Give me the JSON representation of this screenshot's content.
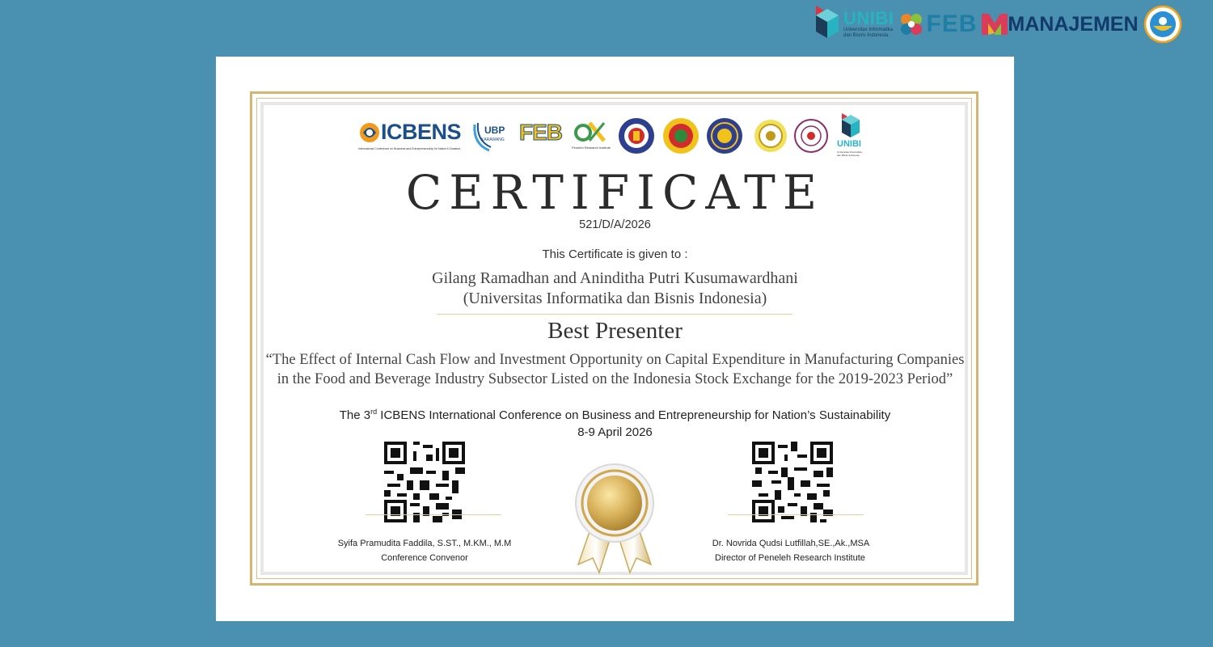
{
  "header": {
    "unibi_name": "UNIBI",
    "unibi_sub_line1": "Universitas Informatika",
    "unibi_sub_line2": "dan Bisnis Indonesia",
    "feb_label": "FEB",
    "manajemen_label": "MANAJEMEN",
    "badge_icon": "seal-badge-icon"
  },
  "logos": {
    "icbens_name": "ICBENS",
    "icbens_tagline": "International Conference on Business and Entrepreneurship for Nation's Sustainability",
    "ubp_label": "UBP",
    "ubp_sub": "KARAWANG",
    "feb_label": "FEB",
    "peneleh_label": "Peneleh Research Institute",
    "unibi_label": "UNIBI",
    "unibi_sub": "Universitas Informatika dan Bisnis Indonesia"
  },
  "certificate": {
    "title": "CERTIFICATE",
    "number": "521/D/A/2026",
    "given_to": "This Certificate is given to :",
    "recipient": "Gilang Ramadhan and Aninditha Putri Kusumawardhani",
    "affiliation": "(Universitas Informatika dan Bisnis Indonesia)",
    "award": "Best Presenter",
    "paper_title": "“The Effect of Internal Cash Flow and Investment Opportunity on Capital Expenditure in Manufacturing Companies in the Food and Beverage Industry Subsector Listed on the Indonesia Stock Exchange for the 2019-2023 Period”",
    "conference_prefix": "The 3",
    "conference_sup": "rd",
    "conference_rest": " ICBENS International Conference on Business and Entrepreneurship for Nation’s Sustainability",
    "date": "8-9 April 2026"
  },
  "signatories": {
    "left": {
      "name": "Syifa Pramudita Faddila, S.ST., M.KM., M.M",
      "role": "Conference Convenor"
    },
    "right": {
      "name": "Dr. Novrida Qudsi Lutfillah,SE.,Ak.,MSA",
      "role": "Director of Peneleh Research Institute"
    }
  },
  "colors": {
    "background": "#4a90b0",
    "gold": "#d5b671",
    "unibi_teal": "#27b3c2"
  }
}
